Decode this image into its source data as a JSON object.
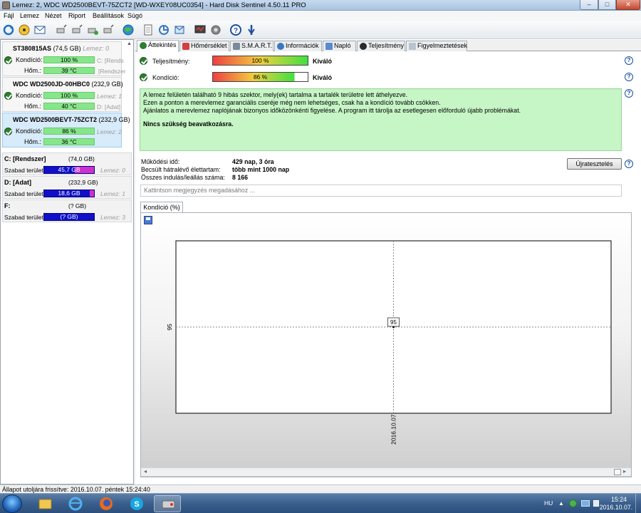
{
  "window": {
    "title": "Lemez: 2, WDC WD2500BEVT-75ZCT2 [WD-WXEY08UC0354]  -  Hard Disk Sentinel 4.50.11 PRO",
    "minimize": "–",
    "maximize": "□",
    "close": "✕"
  },
  "menu": [
    "Fájl",
    "Lemez",
    "Nézet",
    "Riport",
    "Beállítások",
    "Súgó"
  ],
  "toolbar_icons": [
    "refresh-icon",
    "disk-info-icon",
    "mail-icon",
    "network-icon",
    "network-add-icon",
    "network-remove-icon",
    "network-settings-icon",
    "globe-icon",
    "document-icon",
    "copy-icon",
    "email-report-icon",
    "test-icon",
    "settings-icon",
    "help-icon",
    "info-icon"
  ],
  "disks": [
    {
      "name": "ST380815AS",
      "size": "(74,5 GB)",
      "id": "Lemez: 0",
      "condition_label": "Kondíció:",
      "condition": "100 %",
      "condition_extra": "C: [Rends",
      "temp_label": "Hőm.:",
      "temp": "39 °C",
      "temp_extra": "[Rendszer"
    },
    {
      "name": "WDC WD2500JD-00HBC0",
      "size": "(232,9 GB)",
      "id": "",
      "condition_label": "Kondíció:",
      "condition": "100 %",
      "condition_extra": "Lemez: 1",
      "temp_label": "Hőm.:",
      "temp": "40 °C",
      "temp_extra": "D: [Adat]"
    },
    {
      "name": "WDC WD2500BEVT-75ZCT2",
      "size": "(232,9 GB)",
      "id": "",
      "condition_label": "Kondíció:",
      "condition": "86 %",
      "condition_extra": "Lemez: 2",
      "temp_label": "Hőm.:",
      "temp": "36 °C",
      "temp_extra": ""
    }
  ],
  "volumes": [
    {
      "name": "C: [Rendszer]",
      "size": "(74,0 GB)",
      "free_label": "Szabad terület",
      "free": "45,7 GB",
      "used_pct": 0.38,
      "disk": "Lemez: 0"
    },
    {
      "name": "D: [Adat]",
      "size": "(232,9 GB)",
      "free_label": "Szabad terület",
      "free": "18,6 GB",
      "used_pct": 0.08,
      "disk": "Lemez: 1"
    },
    {
      "name": "F:",
      "size": "(? GB)",
      "free_label": "Szabad terület",
      "free": "(? GB)",
      "used_pct": 0,
      "disk": "Lemez: 3"
    }
  ],
  "tabs": [
    "Áttekintés",
    "Hőmérséklet",
    "S.M.A.R.T.",
    "Információk",
    "Napló",
    "Teljesítmény",
    "Figyelmeztetések"
  ],
  "overview": {
    "performance_label": "Teljesítmény:",
    "performance_value": "100 %",
    "performance_pct": 1.0,
    "performance_status": "Kiváló",
    "condition_label": "Kondíció:",
    "condition_value": "86 %",
    "condition_pct": 0.86,
    "condition_status": "Kiváló",
    "message_lines": [
      "A lemez felületén található 9 hibás szektor, mely(ek) tartalma a tartalék területre lett áthelyezve.",
      "Ezen a ponton a merevlemez garanciális cseréje még nem lehetséges, csak ha a kondíció tovább csökken.",
      "Ajánlatos a merevlemez naplójának bizonyos időközönkénti figyelése. A program itt tárolja az esetlegesen előforduló újabb problémákat."
    ],
    "message_bold": "Nincs szükség beavatkozásra.",
    "uptime_label": "Működési idő:",
    "uptime_value": "429 nap, 3 óra",
    "lifetime_label": "Becsült hátralévő élettartam:",
    "lifetime_value": "több mint 1000 nap",
    "startstop_label": "Összes indulás/leállás száma:",
    "startstop_value": "8 166",
    "retest_button": "Újratesztelés",
    "note_placeholder": "Kattintson megjegyzés megadásához ...",
    "help": "?"
  },
  "chart_tab": "Kondíció  (%)",
  "chart_data": {
    "type": "line",
    "x": [
      "2016.10.07."
    ],
    "series": [
      {
        "values": [
          95
        ]
      }
    ],
    "xlabel": "",
    "ylabel": "",
    "y_tick_labels": [
      "95"
    ],
    "x_tick_labels": [
      "2016.10.07."
    ],
    "data_labels": [
      "95"
    ],
    "grid": true
  },
  "status_bar": "Állapot utoljára frissítve: 2016.10.07. péntek 15:24:40",
  "taskbar": {
    "apps": [
      "explorer-icon",
      "ie-icon",
      "firefox-icon",
      "skype-icon",
      "hds-icon"
    ],
    "language": "HU",
    "time": "15:24",
    "date": "2016.10.07.",
    "skype_letter": "S"
  }
}
